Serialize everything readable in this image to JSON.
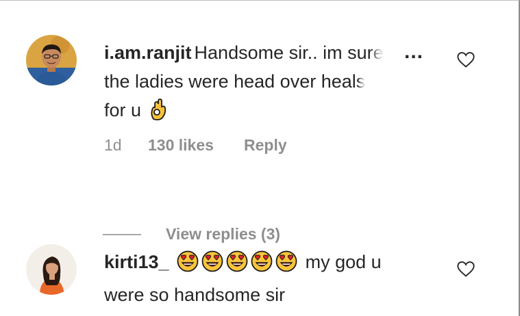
{
  "comments": [
    {
      "username": "i.am.ranjit",
      "text_main": "Handsome sir.. im su",
      "text_fade": "re",
      "more": "...",
      "text_line2_main": "the ladies were head over heal",
      "text_line2_fade": "s",
      "text_line3": "for u",
      "emoji_icon": "ok-hand-emoji",
      "time": "1d",
      "likes": "130 likes",
      "reply": "Reply",
      "view_replies": "View replies (3)"
    },
    {
      "username": "kirti13_",
      "emoji_icon": "heart-eyes-emoji",
      "emoji_count": 5,
      "text_after": "my god u",
      "text_line2": "were so handsome sir"
    }
  ],
  "colors": {
    "text": "#262626",
    "secondary": "#8e8e8e",
    "heart_outline": "#262626"
  }
}
